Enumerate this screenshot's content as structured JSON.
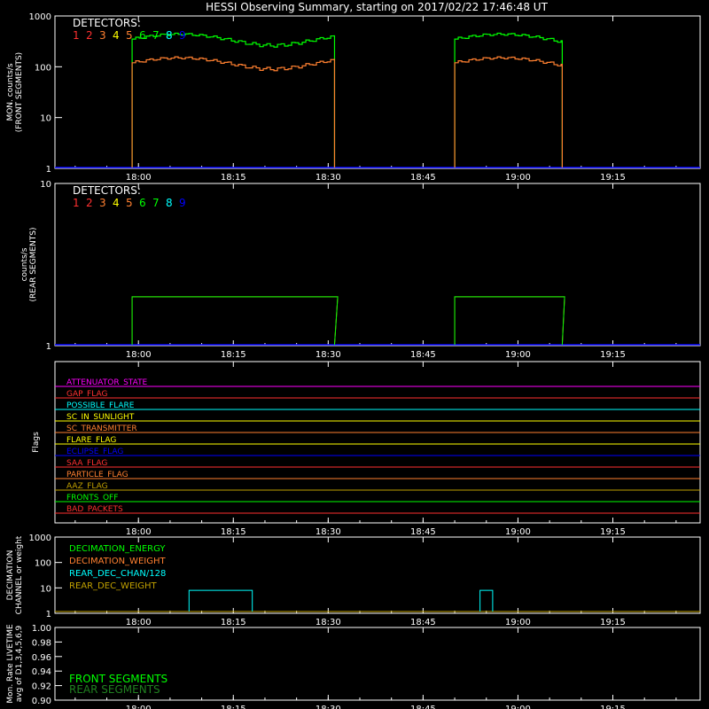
{
  "title": "HESSI Observing Summary, starting on 2017/02/22 17:46:48 UT",
  "time_ticks": [
    "18:00",
    "18:15",
    "18:30",
    "18:45",
    "19:00",
    "19:15"
  ],
  "colors": {
    "frame": "#ffffff",
    "det": [
      "#ff3030",
      "#ff3030",
      "#ff8030",
      "#ffff00",
      "#ff8030",
      "#00ff00",
      "#00ff00",
      "#00ffff",
      "#0000ff"
    ],
    "front": "#00ff00",
    "rear": "#ff8030",
    "base": "#0000ff"
  },
  "chart_data": [
    {
      "type": "line",
      "ylabel": "MON. counts/s\n(FRONT SEGMENTS)",
      "ylog": true,
      "ylim": [
        1,
        1000
      ],
      "yticks": [
        "1",
        "10",
        "100",
        "1000"
      ],
      "legend": {
        "title": "DETECTORS:",
        "digits": [
          "1",
          "2",
          "3",
          "4",
          "5",
          "6",
          "7",
          "8",
          "9"
        ]
      },
      "series": [
        {
          "x_start": "17:59",
          "x_end": "18:31",
          "green": 350,
          "orange": 120
        },
        {
          "x_start": "18:50",
          "x_end": "19:07",
          "green": 350,
          "orange": 120
        }
      ]
    },
    {
      "type": "line",
      "ylabel": "counts/s\n(REAR SEGMENTS)",
      "ylog": true,
      "ylim": [
        1,
        10
      ],
      "yticks": [
        "1",
        "10"
      ],
      "legend": {
        "title": "DETECTORS:",
        "digits": [
          "1",
          "2",
          "3",
          "4",
          "5",
          "6",
          "7",
          "8",
          "9"
        ]
      },
      "windows": [
        [
          "17:59",
          "18:31"
        ],
        [
          "18:50",
          "19:07"
        ]
      ]
    },
    {
      "type": "line",
      "ylabel": "Flags",
      "flags": [
        {
          "name": "ATTENUATOR_STATE",
          "color": "#ff00ff"
        },
        {
          "name": "GAP_FLAG",
          "color": "#ff3030"
        },
        {
          "name": "POSSIBLE_FLARE",
          "color": "#00ffff"
        },
        {
          "name": "SC_IN_SUNLIGHT",
          "color": "#ffff00"
        },
        {
          "name": "SC_TRANSMITTER",
          "color": "#ff8030"
        },
        {
          "name": "FLARE_FLAG",
          "color": "#ffff00"
        },
        {
          "name": "ECLIPSE_FLAG",
          "color": "#0000ff"
        },
        {
          "name": "SAA_FLAG",
          "color": "#ff3030"
        },
        {
          "name": "PARTICLE_FLAG",
          "color": "#ff8030"
        },
        {
          "name": "AAZ_FLAG",
          "color": "#c0a000"
        },
        {
          "name": "FRONTS_OFF",
          "color": "#00ff00"
        },
        {
          "name": "BAD_PACKETS",
          "color": "#ff3030"
        }
      ]
    },
    {
      "type": "line",
      "ylabel": "DECIMATION\nCHANNEL or weight",
      "ylog": true,
      "ylim": [
        1,
        1000
      ],
      "yticks": [
        "1",
        "10",
        "100",
        "1000"
      ],
      "legend_entries": [
        {
          "name": "DECIMATION_ENERGY",
          "color": "#00ff00"
        },
        {
          "name": "DECIMATION_WEIGHT",
          "color": "#ff8030"
        },
        {
          "name": "REAR_DEC_CHAN/128",
          "color": "#00ffff"
        },
        {
          "name": "REAR_DEC_WEIGHT",
          "color": "#c0a000"
        }
      ]
    },
    {
      "type": "line",
      "ylabel": "Mon. Rate LIVETIME\navg of D1,3,4,5,6,9",
      "ylim": [
        0.9,
        1.0
      ],
      "yticks": [
        "0.90",
        "0.92",
        "0.94",
        "0.96",
        "0.98",
        "1.00"
      ],
      "legend_entries": [
        {
          "name": "FRONT SEGMENTS",
          "color": "#00ff00"
        },
        {
          "name": "REAR SEGMENTS",
          "color": "#208020"
        }
      ]
    }
  ]
}
